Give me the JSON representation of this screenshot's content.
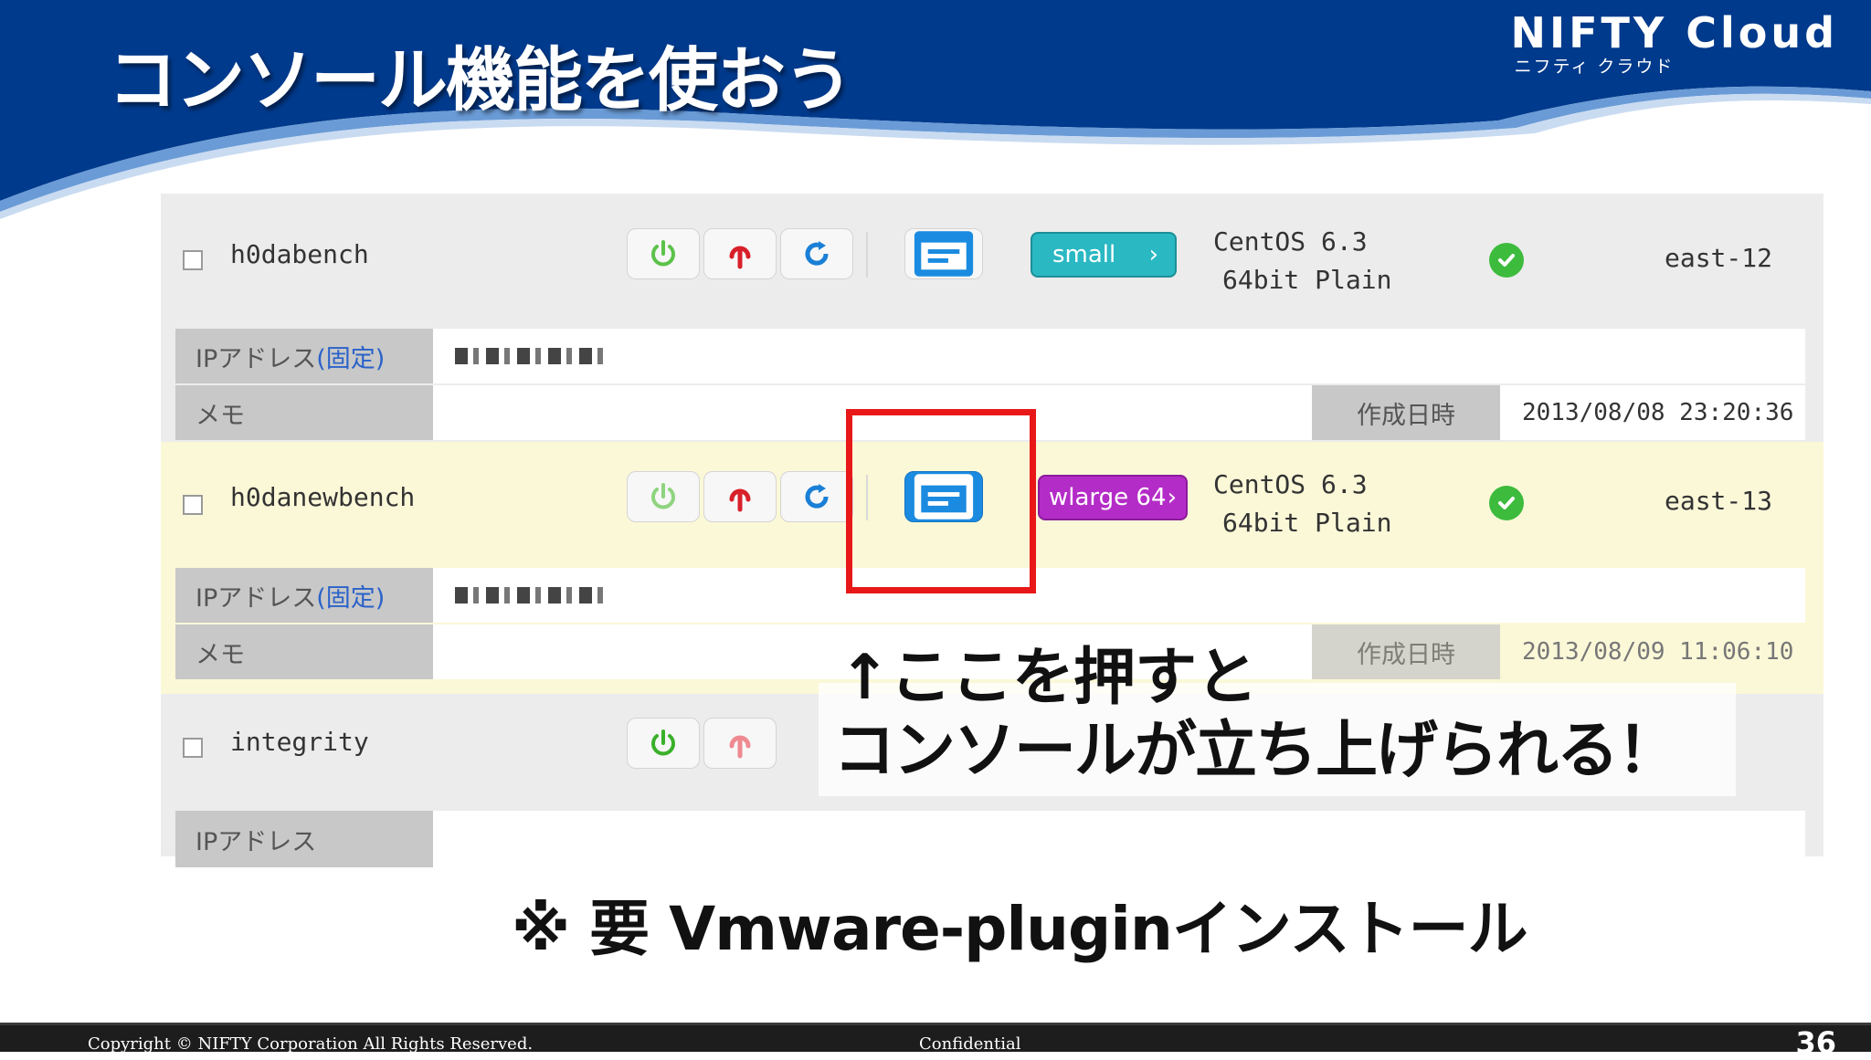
{
  "slide": {
    "title": "コンソール機能を使おう",
    "page_number": "36"
  },
  "brand": {
    "name": "NIFTY Cloud",
    "kana": "ニフティ クラウド"
  },
  "colors": {
    "header_blue": "#003a8c",
    "highlight_red": "#e81818",
    "console_active_blue": "#1a8be0",
    "badge_small": "#2ab8c3",
    "badge_wlarge": "#b42cc7",
    "status_green": "#3dbb3d"
  },
  "servers": [
    {
      "name": "h0dabench",
      "type": "small",
      "os_line1": "CentOS 6.3",
      "os_line2": "64bit Plain",
      "zone": "east-12",
      "ip_label_prefix": "IPアドレス",
      "ip_label_fixed": "(固定)",
      "memo_label": "メモ",
      "created_label": "作成日時",
      "created_value": "2013/08/08 23:20:36"
    },
    {
      "name": "h0danewbench",
      "type": "wlarge 64",
      "os_line1": "CentOS 6.3",
      "os_line2": "64bit Plain",
      "zone": "east-13",
      "ip_label_prefix": "IPアドレス",
      "ip_label_fixed": "(固定)",
      "memo_label": "メモ",
      "created_label": "作成日時",
      "created_value": "2013/08/09 11:06:10"
    },
    {
      "name": "integrity",
      "ip_label_prefix": "IPアドレス"
    }
  ],
  "icons": {
    "power_on": "power-icon",
    "power_off": "power-off-icon",
    "restart": "restart-icon",
    "console": "console-icon",
    "status_ok": "check-circle-icon",
    "chevron": "chevron-right-icon"
  },
  "callout": {
    "line1": "↑ここを押すと",
    "line2": "コンソールが立ち上げられる！"
  },
  "note": "※ 要 Vmware-pluginインストール",
  "footer": {
    "copyright": "Copyright © NIFTY Corporation All Rights Reserved.",
    "confidential": "Confidential"
  }
}
